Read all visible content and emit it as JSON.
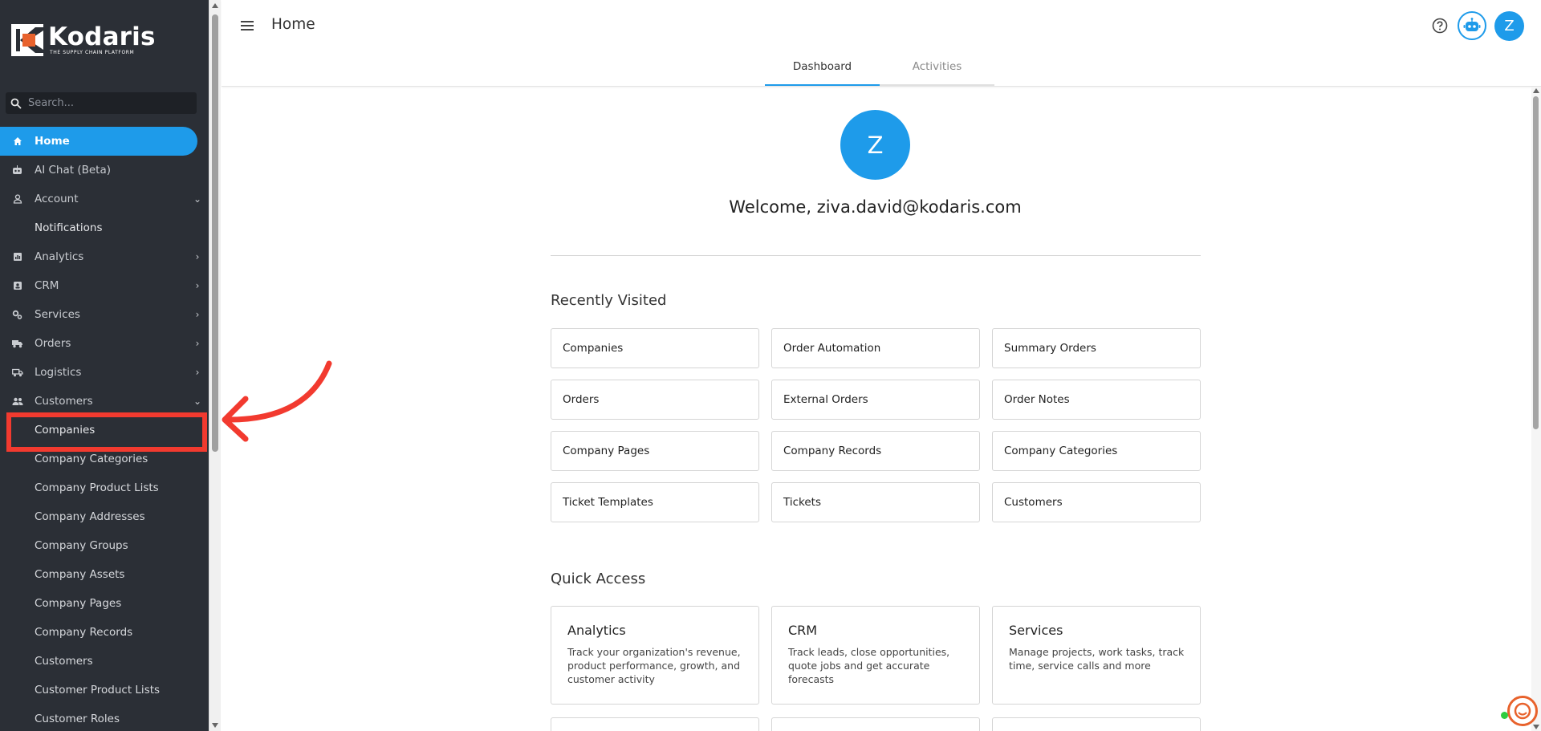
{
  "brand": {
    "name": "Kodaris",
    "tagline": "THE SUPPLY CHAIN PLATFORM",
    "accent": "#1e9bea",
    "logo_orange": "#e8622c"
  },
  "search": {
    "placeholder": "Search..."
  },
  "sidebar": {
    "items": [
      {
        "label": "Home",
        "icon": "home-icon",
        "active": true
      },
      {
        "label": "AI Chat (Beta)",
        "icon": "robot-icon"
      },
      {
        "label": "Account",
        "icon": "person-icon",
        "chevron": "down"
      },
      {
        "label": "Notifications",
        "sub": true
      },
      {
        "label": "Analytics",
        "icon": "chart-icon",
        "chevron": "right"
      },
      {
        "label": "CRM",
        "icon": "contact-icon",
        "chevron": "right"
      },
      {
        "label": "Services",
        "icon": "gears-icon",
        "chevron": "right"
      },
      {
        "label": "Orders",
        "icon": "truck-icon",
        "chevron": "right"
      },
      {
        "label": "Logistics",
        "icon": "shipping-icon",
        "chevron": "right"
      },
      {
        "label": "Customers",
        "icon": "people-icon",
        "chevron": "down"
      },
      {
        "label": "Companies",
        "sub": true
      },
      {
        "label": "Company Categories",
        "sub": true
      },
      {
        "label": "Company Product Lists",
        "sub": true
      },
      {
        "label": "Company Addresses",
        "sub": true
      },
      {
        "label": "Company Groups",
        "sub": true
      },
      {
        "label": "Company Assets",
        "sub": true
      },
      {
        "label": "Company Pages",
        "sub": true
      },
      {
        "label": "Company Records",
        "sub": true
      },
      {
        "label": "Customers",
        "sub": true
      },
      {
        "label": "Customer Product Lists",
        "sub": true
      },
      {
        "label": "Customer Roles",
        "sub": true
      }
    ]
  },
  "header": {
    "title": "Home"
  },
  "tabs": [
    {
      "label": "Dashboard",
      "active": true
    },
    {
      "label": "Activities",
      "active": false
    }
  ],
  "user": {
    "initial": "Z",
    "welcome": "Welcome, ziva.david@kodaris.com"
  },
  "recently_visited": {
    "title": "Recently Visited",
    "items": [
      "Companies",
      "Order Automation",
      "Summary Orders",
      "Orders",
      "External Orders",
      "Order Notes",
      "Company Pages",
      "Company Records",
      "Company Categories",
      "Ticket Templates",
      "Tickets",
      "Customers"
    ]
  },
  "quick_access": {
    "title": "Quick Access",
    "items": [
      {
        "title": "Analytics",
        "desc": "Track your organization's revenue, product performance, growth, and customer activity"
      },
      {
        "title": "CRM",
        "desc": "Track leads, close opportunities, quote jobs and get accurate forecasts"
      },
      {
        "title": "Services",
        "desc": "Manage projects, work tasks, track time, service calls and more"
      }
    ]
  }
}
